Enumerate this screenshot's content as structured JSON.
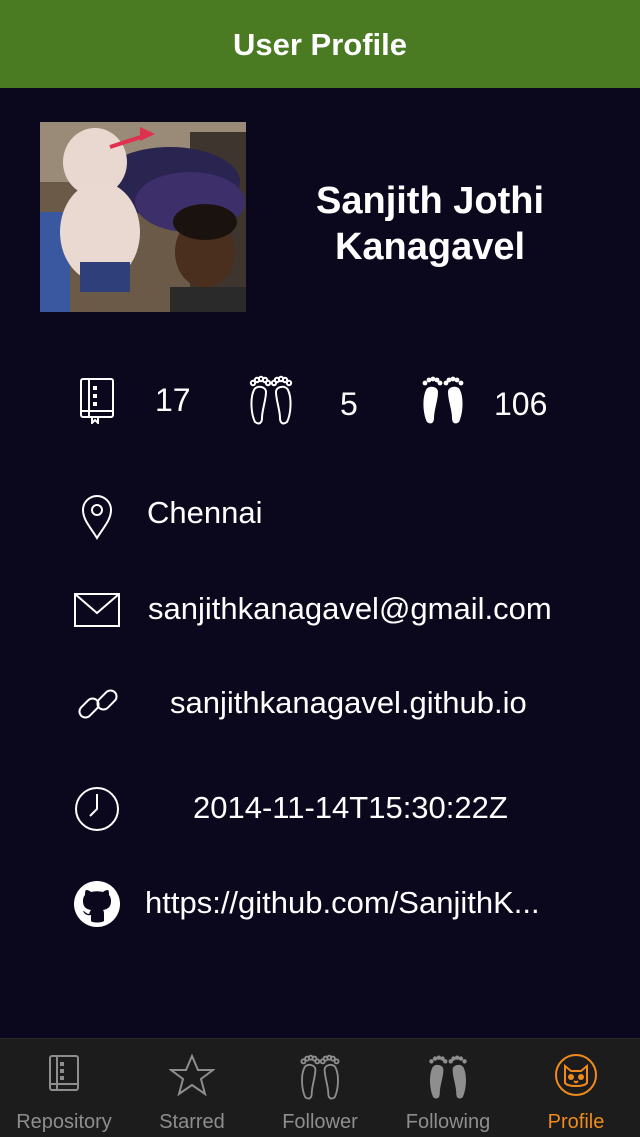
{
  "header": {
    "title": "User Profile"
  },
  "profile": {
    "name_line1": "Sanjith Jothi",
    "name_line2": "Kanagavel"
  },
  "stats": {
    "repos": "17",
    "followers": "5",
    "following": "106"
  },
  "info": {
    "location": "Chennai",
    "email": "sanjithkanagavel@gmail.com",
    "blog": "sanjithkanagavel.github.io",
    "created_at": "2014-11-14T15:30:22Z",
    "github_url": "https://github.com/SanjithK..."
  },
  "tabs": [
    {
      "label": "Repository",
      "icon": "repository-icon",
      "active": false
    },
    {
      "label": "Starred",
      "icon": "star-icon",
      "active": false
    },
    {
      "label": "Follower",
      "icon": "follower-feet-icon",
      "active": false
    },
    {
      "label": "Following",
      "icon": "following-feet-icon",
      "active": false
    },
    {
      "label": "Profile",
      "icon": "cat-icon",
      "active": true
    }
  ],
  "colors": {
    "header_bg": "#4a7a22",
    "background": "#0b081e",
    "tab_active": "#f08a1c",
    "tab_inactive": "#8e8e8e"
  }
}
